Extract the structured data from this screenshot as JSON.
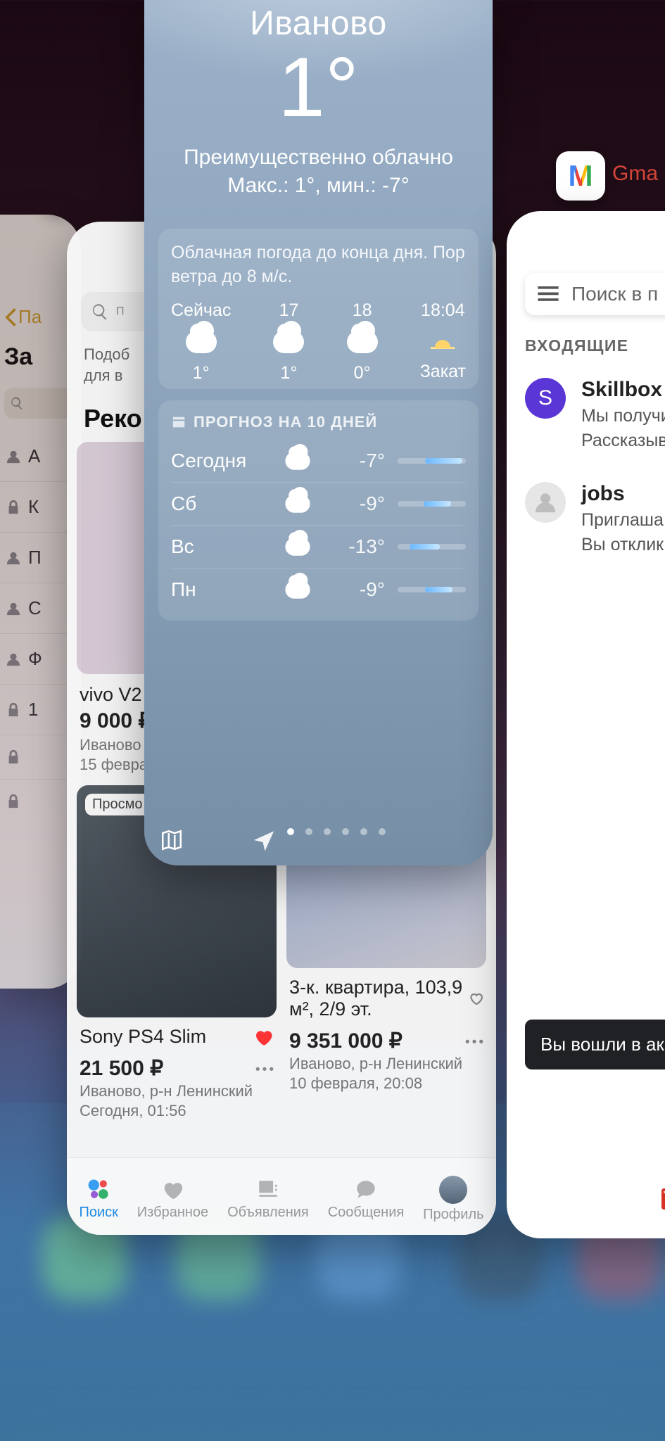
{
  "notes": {
    "back_label": "Па",
    "title": "За",
    "rows": [
      "А",
      "К",
      "П",
      "С",
      "Ф",
      "1"
    ],
    "locked": [
      false,
      true,
      false,
      false,
      false,
      true,
      true,
      true
    ]
  },
  "avito": {
    "search_placeholder": "П",
    "subtitle_l1": "Подоб",
    "subtitle_l2": "для в",
    "heading": "Реко",
    "tabs": {
      "search": "Поиск",
      "fav": "Избранное",
      "ads": "Объявления",
      "msg": "Сообщения",
      "profile": "Профиль"
    },
    "items": [
      {
        "title": "vivo V2",
        "price": "9 000 ₽",
        "meta1": "Иваново",
        "meta2": "15 февра",
        "badge": ""
      },
      {
        "title": "Sony PS4 Slim",
        "price": "21 500 ₽",
        "meta1": "Иваново, р-н Ленинский",
        "meta2": "Сегодня, 01:56",
        "badge": "Просмо",
        "fav": true
      },
      {
        "title": "3-к. квартира, 103,9 м², 2/9 эт.",
        "price": "9 351 000 ₽",
        "meta1": "Иваново, р-н Ленинский",
        "meta2": "10 февраля, 20:08",
        "fav": false
      }
    ]
  },
  "weather": {
    "city": "Иваново",
    "temp": "1°",
    "cond": "Преимущественно облачно",
    "range": "Макс.: 1°, мин.: -7°",
    "lead": "Облачная погода до конца дня. Пор ветра до 8 м/с.",
    "hourly": [
      {
        "t": "Сейчас",
        "v": "1°",
        "k": "cloud"
      },
      {
        "t": "17",
        "v": "1°",
        "k": "cloud"
      },
      {
        "t": "18",
        "v": "0°",
        "k": "cloud"
      },
      {
        "t": "18:04",
        "v": "Закат",
        "k": "sunset"
      }
    ],
    "forecast_title": "ПРОГНОЗ НА 10 ДНЕЙ",
    "days": [
      {
        "d": "Сегодня",
        "low": "-7°",
        "bar": [
          40,
          95
        ]
      },
      {
        "d": "Сб",
        "low": "-9°",
        "bar": [
          38,
          78
        ]
      },
      {
        "d": "Вс",
        "low": "-13°",
        "bar": [
          18,
          62
        ]
      },
      {
        "d": "Пн",
        "low": "-9°",
        "bar": [
          40,
          80
        ]
      }
    ]
  },
  "gmail": {
    "icon_label": "Gma",
    "search_placeholder": "Поиск в п",
    "section": "ВХОДЯЩИЕ",
    "mails": [
      {
        "avatar": "S",
        "sender": "Skillbox",
        "l1": "Мы получи",
        "l2": "Рассказыв"
      },
      {
        "avatar": "",
        "sender": "jobs",
        "l1": "Приглаша",
        "l2": "Вы отклик"
      }
    ],
    "toast": "Вы вошли в акка"
  }
}
